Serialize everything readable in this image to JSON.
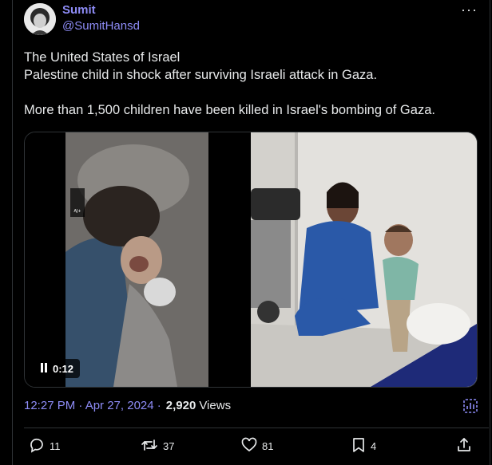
{
  "author": {
    "display_name": "Sumit",
    "handle": "@SumitHansd"
  },
  "post": {
    "lines": [
      "The United States of Israel",
      "Palestine child in shock after surviving Israeli attack in Gaza.",
      "",
      "More than 1,500 children have been killed in Israel's bombing of Gaza."
    ],
    "video_duration": "0:12",
    "timestamp": "12:27 PM · Apr 27, 2024 ·",
    "views_count": "2,920",
    "views_label": "Views"
  },
  "actions": {
    "replies": "11",
    "reposts": "37",
    "likes": "81",
    "bookmarks": "4"
  },
  "colors": {
    "accent": "#8e8cf7",
    "background": "#000000",
    "text": "#e7e9ea",
    "border": "#2f3336"
  },
  "icons": [
    "more-icon",
    "play-pause-icon",
    "analytics-icon",
    "reply-icon",
    "repost-icon",
    "like-icon",
    "bookmark-icon",
    "share-icon"
  ]
}
